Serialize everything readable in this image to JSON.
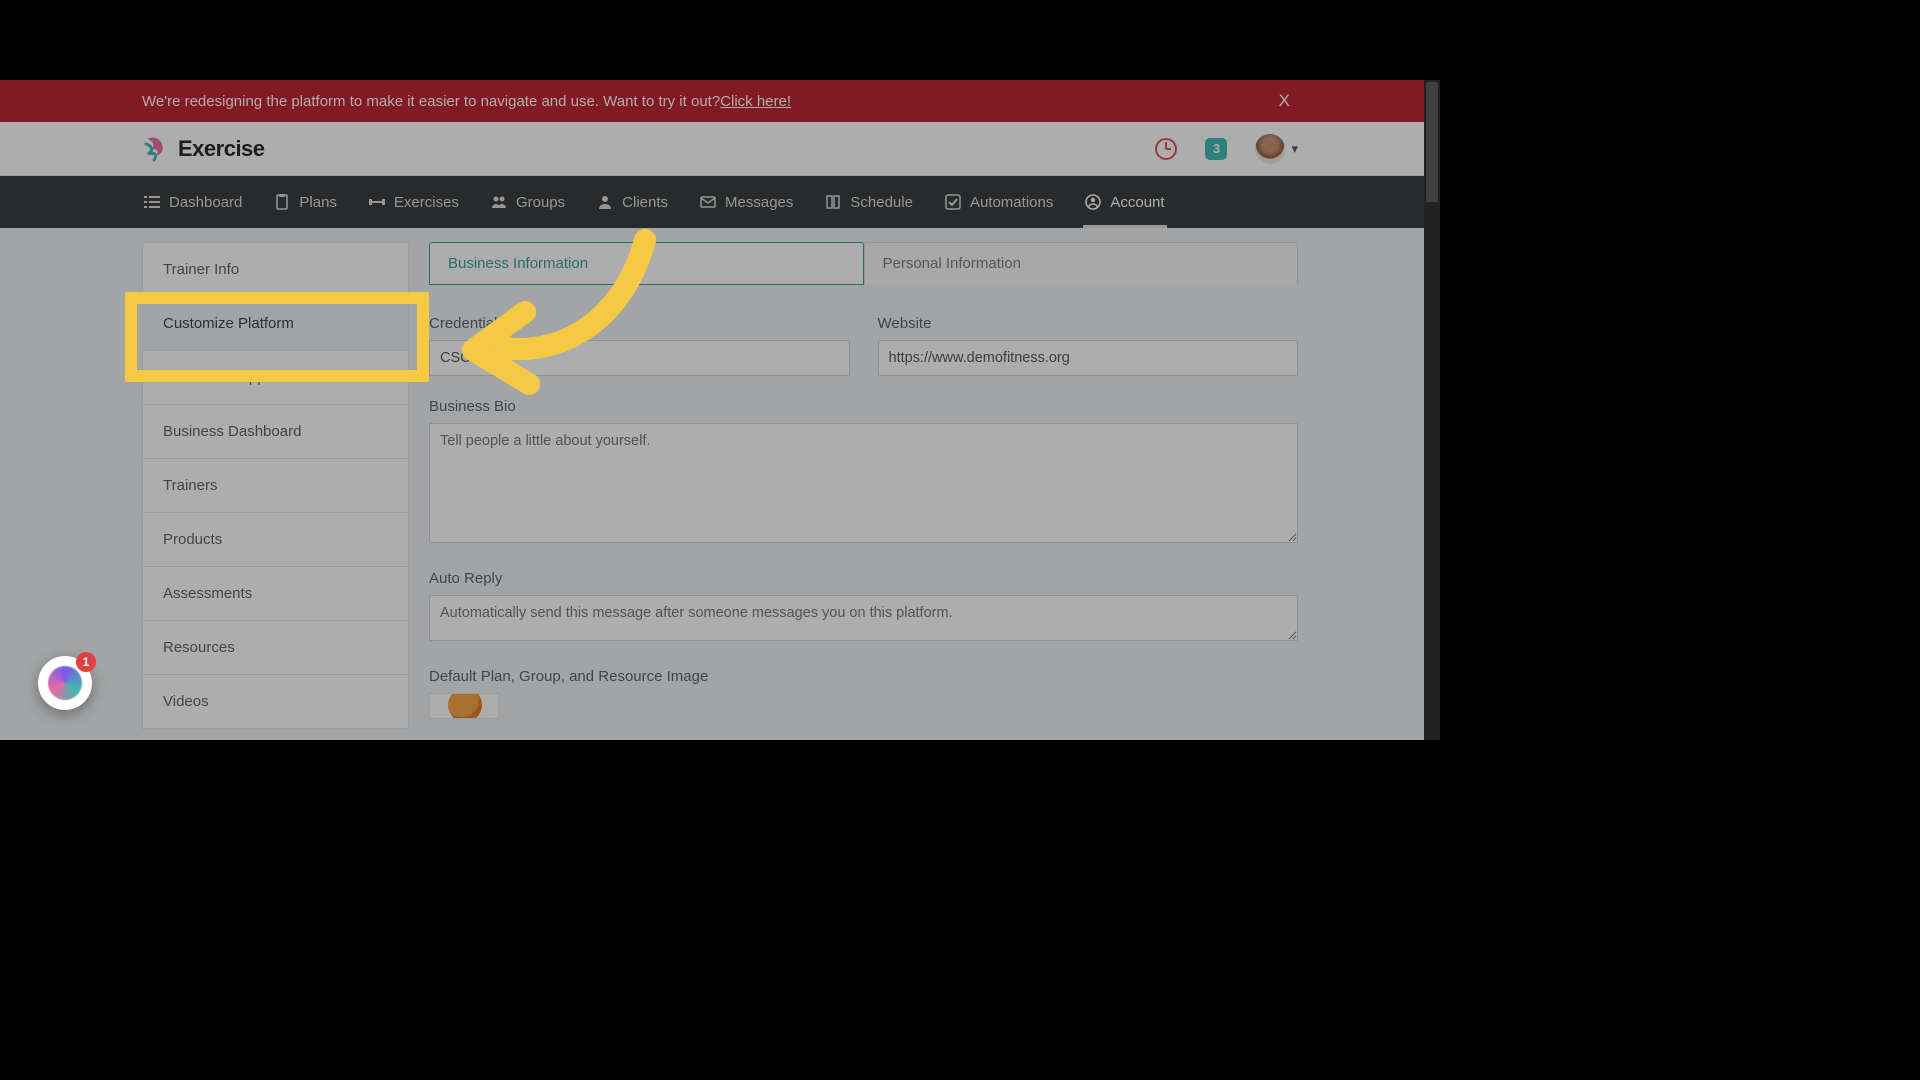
{
  "banner": {
    "text_prefix": "We're redesigning the platform to make it easier to navigate and use. Want to try it out? ",
    "link_text": "Click here!",
    "close_label": "X"
  },
  "brand": {
    "name": "Exercise"
  },
  "header": {
    "notification_count": "3"
  },
  "nav": {
    "items": [
      {
        "label": "Dashboard",
        "active": false
      },
      {
        "label": "Plans",
        "active": false
      },
      {
        "label": "Exercises",
        "active": false
      },
      {
        "label": "Groups",
        "active": false
      },
      {
        "label": "Clients",
        "active": false
      },
      {
        "label": "Messages",
        "active": false
      },
      {
        "label": "Schedule",
        "active": false
      },
      {
        "label": "Automations",
        "active": false
      },
      {
        "label": "Account",
        "active": true
      }
    ]
  },
  "sidebar": {
    "items": [
      {
        "label": "Trainer Info"
      },
      {
        "label": "Customize Platform"
      },
      {
        "label": "Connected Apps"
      },
      {
        "label": "Business Dashboard"
      },
      {
        "label": "Trainers"
      },
      {
        "label": "Products"
      },
      {
        "label": "Assessments"
      },
      {
        "label": "Resources"
      },
      {
        "label": "Videos"
      }
    ],
    "highlighted_index": 1
  },
  "tabs": {
    "items": [
      {
        "label": "Business Information",
        "active": true
      },
      {
        "label": "Personal Information",
        "active": false
      }
    ]
  },
  "form": {
    "credentials": {
      "label": "Credentials",
      "value": "CSCS"
    },
    "website": {
      "label": "Website",
      "value": "https://www.demofitness.org"
    },
    "bio": {
      "label": "Business Bio",
      "placeholder": "Tell people a little about yourself."
    },
    "auto_reply": {
      "label": "Auto Reply",
      "placeholder": "Automatically send this message after someone messages you on this platform."
    },
    "default_image": {
      "label": "Default Plan, Group, and Resource Image"
    }
  },
  "help": {
    "badge": "1"
  },
  "colors": {
    "banner_bg": "#be1e2d",
    "nav_bg": "#333638",
    "accent": "#3a9b95",
    "highlight": "#f6c945"
  }
}
